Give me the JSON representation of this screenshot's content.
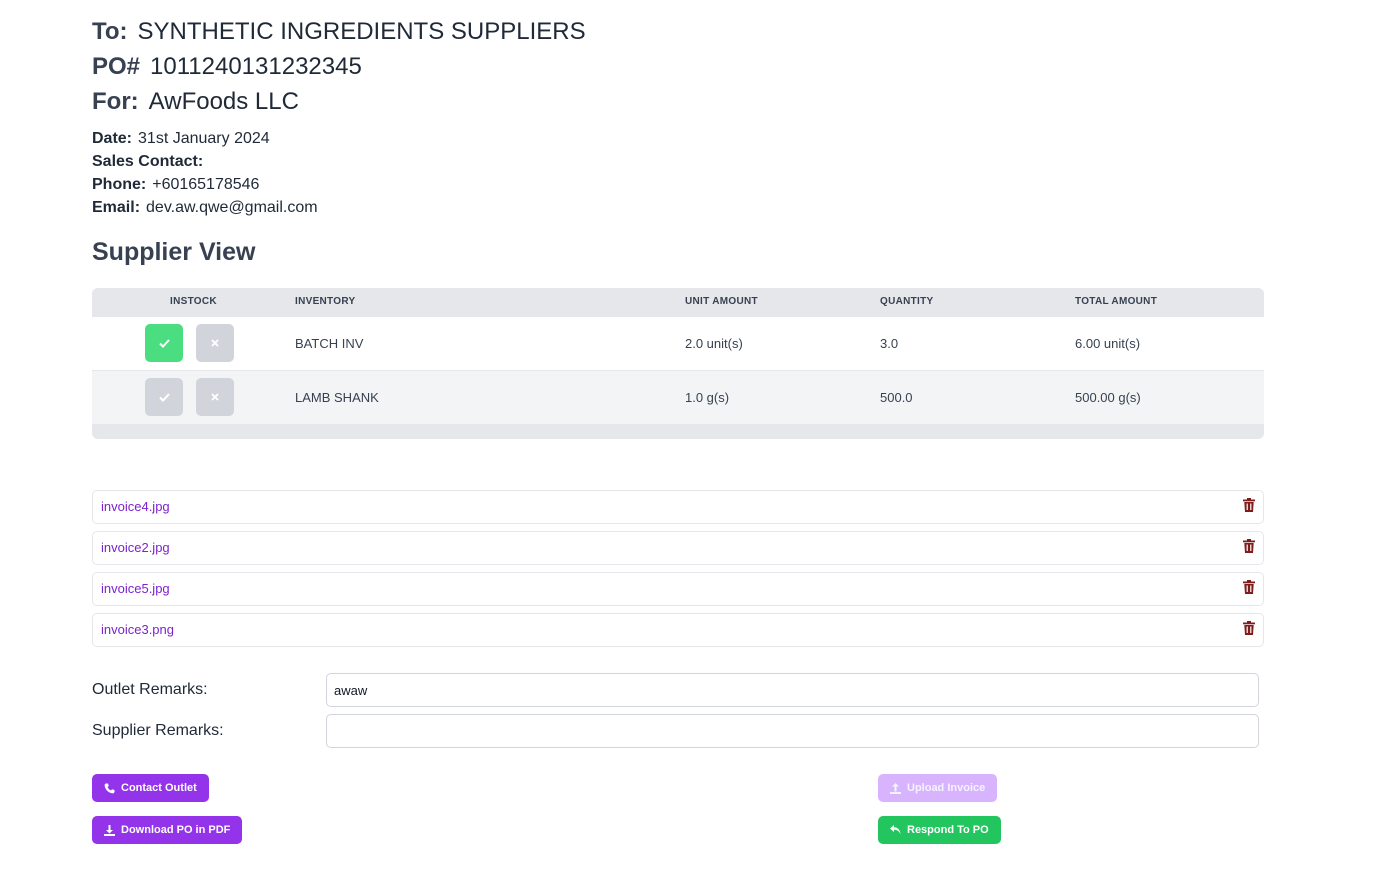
{
  "header": {
    "to_label": "To:",
    "to_value": "SYNTHETIC INGREDIENTS SUPPLIERS",
    "po_label": "PO#",
    "po_value": "1011240131232345",
    "for_label": "For:",
    "for_value": "AwFoods LLC"
  },
  "details": {
    "date_label": "Date:",
    "date_value": "31st January 2024",
    "sales_contact_label": "Sales Contact:",
    "sales_contact_value": "",
    "phone_label": "Phone:",
    "phone_value": "+60165178546",
    "email_label": "Email:",
    "email_value": "dev.aw.qwe@gmail.com"
  },
  "section_title": "Supplier View",
  "table": {
    "columns": [
      "INSTOCK",
      "INVENTORY",
      "UNIT AMOUNT",
      "QUANTITY",
      "TOTAL AMOUNT"
    ],
    "rows": [
      {
        "instock": "yes",
        "inventory": "BATCH INV",
        "unit_amount": "2.0 unit(s)",
        "quantity": "3.0",
        "total_amount": "6.00 unit(s)"
      },
      {
        "instock": "unset",
        "inventory": "LAMB SHANK",
        "unit_amount": "1.0 g(s)",
        "quantity": "500.0",
        "total_amount": "500.00 g(s)"
      }
    ],
    "check_icon": "check-icon",
    "cross_icon": "close-icon"
  },
  "files": [
    {
      "name": "invoice4.jpg"
    },
    {
      "name": "invoice2.jpg"
    },
    {
      "name": "invoice5.jpg"
    },
    {
      "name": "invoice3.png"
    }
  ],
  "remarks": {
    "outlet_label": "Outlet Remarks:",
    "outlet_value": "awaw",
    "supplier_label": "Supplier Remarks:",
    "supplier_value": ""
  },
  "buttons": {
    "contact_outlet": "Contact Outlet",
    "download_pdf": "Download PO in PDF",
    "upload_invoice": "Upload Invoice",
    "respond_po": "Respond To PO"
  },
  "colors": {
    "accent_purple": "#9333ea",
    "accent_green": "#22c55e",
    "instock_green": "#4ade80",
    "trash_red": "#7f1d1d",
    "link_purple": "#7e22ce"
  }
}
